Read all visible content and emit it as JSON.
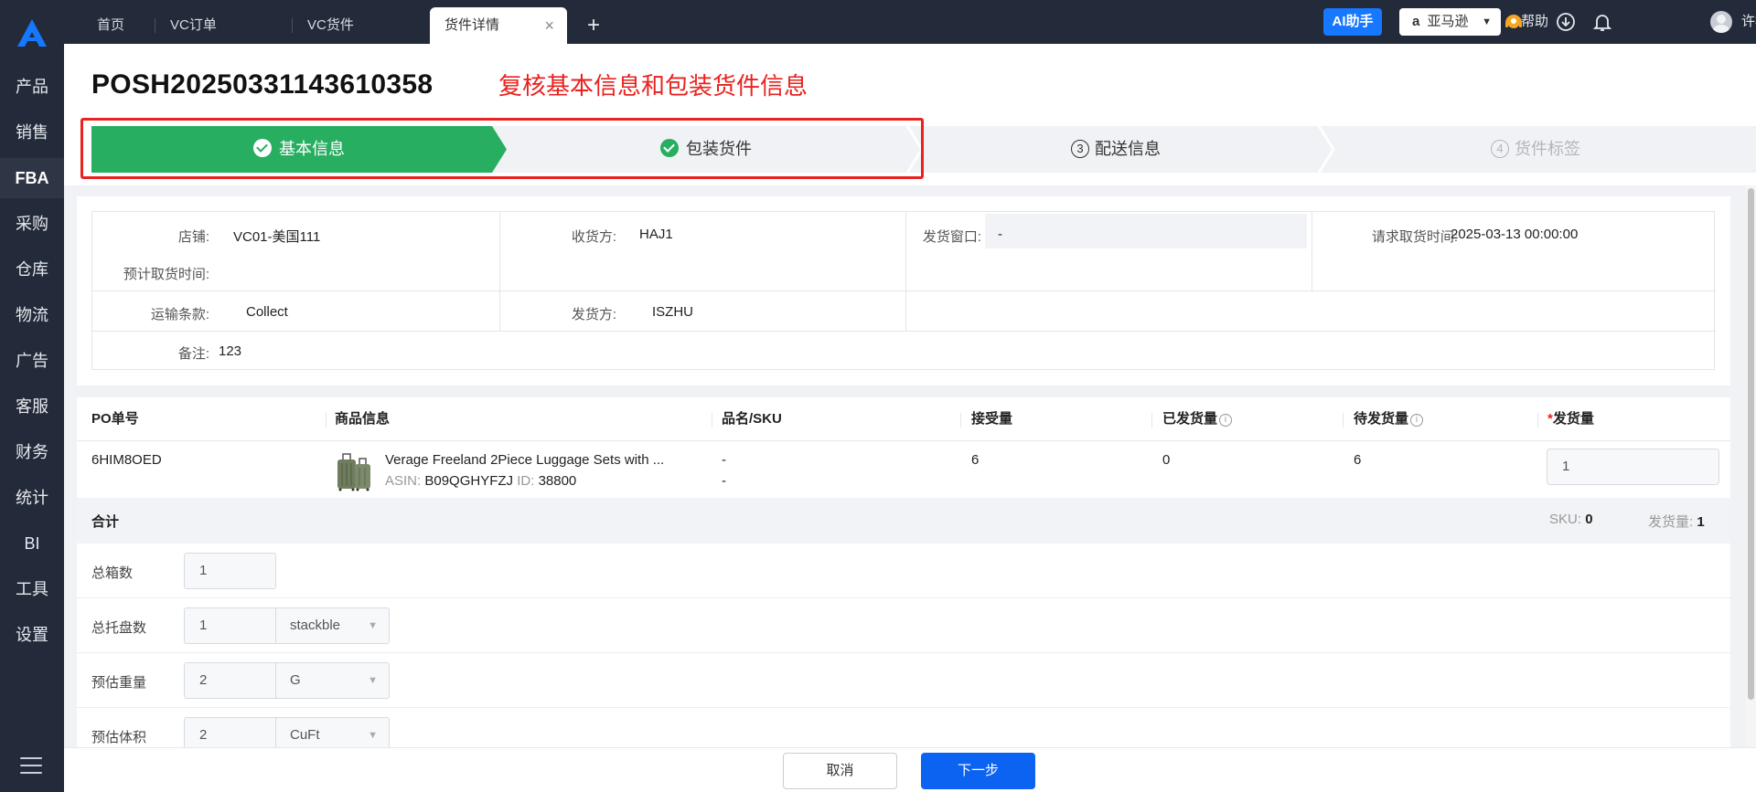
{
  "sidebar": {
    "logo_icon": "brand-a-logo",
    "items": [
      {
        "label": "产品"
      },
      {
        "label": "销售"
      },
      {
        "label": "FBA",
        "active": true
      },
      {
        "label": "采购"
      },
      {
        "label": "仓库"
      },
      {
        "label": "物流"
      },
      {
        "label": "广告"
      },
      {
        "label": "客服"
      },
      {
        "label": "财务"
      },
      {
        "label": "统计"
      },
      {
        "label": "BI"
      },
      {
        "label": "工具"
      },
      {
        "label": "设置"
      }
    ],
    "menu_icon": "hamburger-icon"
  },
  "topbar": {
    "tabs": [
      {
        "label": "首页"
      },
      {
        "label": "VC订单"
      },
      {
        "label": "VC货件"
      },
      {
        "label": "货件详情",
        "active": true,
        "close": "×"
      }
    ],
    "add_tab": "+",
    "ai_button": "AI助手",
    "store": {
      "logo": "a",
      "label": "亚马逊"
    },
    "help": "帮助",
    "icons": [
      "support-agent-icon",
      "download-icon",
      "bell-icon"
    ],
    "user": {
      "name": "许杨"
    }
  },
  "page": {
    "title": "POSH20250331143610358",
    "annotation": "复核基本信息和包装货件信息",
    "annotation_color": "#e8221e"
  },
  "steps": [
    {
      "label": "基本信息",
      "status": "done-active"
    },
    {
      "label": "包装货件",
      "status": "done"
    },
    {
      "label": "配送信息",
      "number": "③",
      "status": "pending"
    },
    {
      "label": "货件标签",
      "number": "④",
      "status": "disabled"
    }
  ],
  "info": {
    "shop_label": "店铺:",
    "shop": "VC01-美国111",
    "receiver_label": "收货方:",
    "receiver": "HAJ1",
    "window_label": "发货窗口:",
    "window": "-",
    "pickup_req_label": "请求取货时间:",
    "pickup_req": "2025-03-13 00:00:00",
    "pickup_est_label": "预计取货时间:",
    "pickup_est": "",
    "terms_label": "运输条款:",
    "terms": "Collect",
    "sender_label": "发货方:",
    "sender": "ISZHU",
    "note_label": "备注:",
    "note": "123"
  },
  "table": {
    "headers": [
      "PO单号",
      "商品信息",
      "品名/SKU",
      "接受量",
      "已发货量",
      "待发货量",
      "发货量"
    ],
    "info_mark": "i",
    "required_mark": "*",
    "rows": [
      {
        "po": "6HIM8OED",
        "product": "Verage Freeland 2Piece Luggage Sets with ...",
        "asin_label": "ASIN:",
        "asin": "B09QGHYFZJ",
        "id_label": "ID:",
        "id": "38800",
        "name": "-",
        "sku": "-",
        "accepted": "6",
        "shipped": "0",
        "pending": "6",
        "qty": "1"
      }
    ],
    "summary": {
      "label": "合计",
      "sku_label": "SKU:",
      "sku": "0",
      "qty_label": "发货量:",
      "qty": "1"
    }
  },
  "form": {
    "boxes_label": "总箱数",
    "boxes": "1",
    "pallets_label": "总托盘数",
    "pallets": "1",
    "pallets_unit": "stackble",
    "weight_label": "预估重量",
    "weight": "2",
    "weight_unit": "G",
    "volume_label": "预估体积",
    "volume": "2",
    "volume_unit": "CuFt"
  },
  "footer": {
    "cancel": "取消",
    "next": "下一步"
  },
  "colors": {
    "sidebar": "#232a39",
    "step_active": "#27ae60",
    "primary": "#0c63f2",
    "ai": "#1677ff"
  }
}
